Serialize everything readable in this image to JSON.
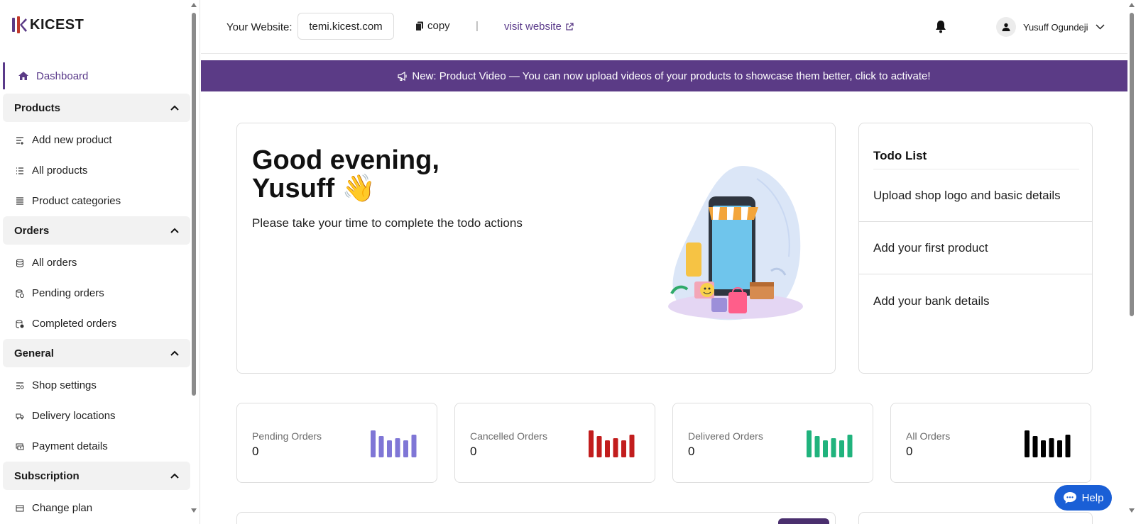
{
  "brand": {
    "name": "KICEST",
    "accent": "#5b3b86"
  },
  "sidebar": {
    "dashboard": {
      "label": "Dashboard",
      "icon": "home-icon"
    },
    "groups": [
      {
        "title": "Products",
        "items": [
          {
            "label": "Add new product",
            "icon": "add-list-icon"
          },
          {
            "label": "All products",
            "icon": "list-icon"
          },
          {
            "label": "Product categories",
            "icon": "categories-icon"
          }
        ]
      },
      {
        "title": "Orders",
        "items": [
          {
            "label": "All orders",
            "icon": "database-icon"
          },
          {
            "label": "Pending orders",
            "icon": "pending-database-icon"
          },
          {
            "label": "Completed orders",
            "icon": "completed-database-icon"
          }
        ]
      },
      {
        "title": "General",
        "items": [
          {
            "label": "Shop settings",
            "icon": "settings-list-icon"
          },
          {
            "label": "Delivery locations",
            "icon": "truck-icon"
          },
          {
            "label": "Payment details",
            "icon": "money-icon"
          }
        ]
      },
      {
        "title": "Subscription",
        "items": [
          {
            "label": "Change plan",
            "icon": "plan-icon"
          }
        ]
      }
    ]
  },
  "topbar": {
    "website_label": "Your Website:",
    "website_value": "temi.kicest.com",
    "copy_label": "copy",
    "separator": "|",
    "visit_label": "visit website",
    "user_name": "Yusuff Ogundeji"
  },
  "banner": {
    "text": "New: Product Video — You can now upload videos of your products to showcase them better, click to activate!"
  },
  "greeting": {
    "line1": "Good evening,",
    "line2": "Yusuff 👋",
    "subtitle": "Please take your time to complete the todo actions"
  },
  "todo": {
    "title": "Todo List",
    "items": [
      "Upload shop logo and basic details",
      "Add your first product",
      "Add your bank details"
    ]
  },
  "stats": [
    {
      "label": "Pending Orders",
      "value": "0",
      "color": "#7f76d6"
    },
    {
      "label": "Cancelled Orders",
      "value": "0",
      "color": "#c21d1d"
    },
    {
      "label": "Delivered Orders",
      "value": "0",
      "color": "#20b37d"
    },
    {
      "label": "All Orders",
      "value": "0",
      "color": "#000000"
    }
  ],
  "help": {
    "label": "Help",
    "color": "#1a5fd6"
  }
}
